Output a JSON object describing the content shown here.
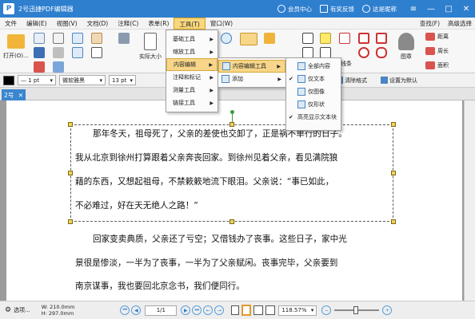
{
  "app": {
    "title": "2号迅捷PDF编辑器",
    "logo": "P"
  },
  "titlebar": {
    "member": "会员中心",
    "feedback": "有奖反馈",
    "username": "这是昵称"
  },
  "menubar": {
    "items": [
      "文件",
      "编辑(E)",
      "视图(V)",
      "文档(D)",
      "注释(C)",
      "表单(R)",
      "工具(T)",
      "窗口(W)"
    ],
    "right": [
      "查找(F)",
      "高级选择"
    ]
  },
  "ribbon": {
    "open_label": "打开(O)...",
    "actual_size_label": "实际大小",
    "stamp_label": "图章",
    "line_label": "线条",
    "shapes": [
      "距离",
      "周长",
      "面积"
    ]
  },
  "toolbar2": {
    "color": "#000000",
    "line_width": "— 1 pt",
    "font": "微软雅黑",
    "font_size": "13 pt",
    "clear_format": "清除格式",
    "set_default": "设置为默认"
  },
  "tab": {
    "label": "2号"
  },
  "menus": {
    "tools": [
      "基础工具",
      "缩放工具",
      "内容编辑",
      "注释和标记",
      "测量工具",
      "链接工具"
    ],
    "content_edit": [
      "内容编辑工具",
      "添加"
    ],
    "content_tools": [
      "全部内容",
      "仅文本",
      "仅图像",
      "仅形状",
      "高亮显示文本块"
    ]
  },
  "document": {
    "para1": [
      "那年冬天，祖母死了，父亲的差使也交卸了，正是祸不单行的日子。",
      "我从北京到徐州打算跟着父亲奔丧回家。到徐州见着父亲，看见满院狼",
      "藉的东西，又想起祖母，不禁簌簌地流下眼泪。父亲说：“事已如此，",
      "不必难过，好在天无绝人之路！”"
    ],
    "para2": [
      "回家变卖典质，父亲还了亏空；又借钱办了丧事。这些日子，家中光",
      "景很是惨淡，一半为了丧事，一半为了父亲赋闲。丧事完毕，父亲要到",
      "南京谋事，我也要回北京念书，我们便同行。"
    ]
  },
  "statusbar": {
    "select_label": "选项...",
    "width": "W: 210.0mm",
    "height": "H: 297.0mm",
    "page": "1/1",
    "zoom": "118.57%"
  }
}
